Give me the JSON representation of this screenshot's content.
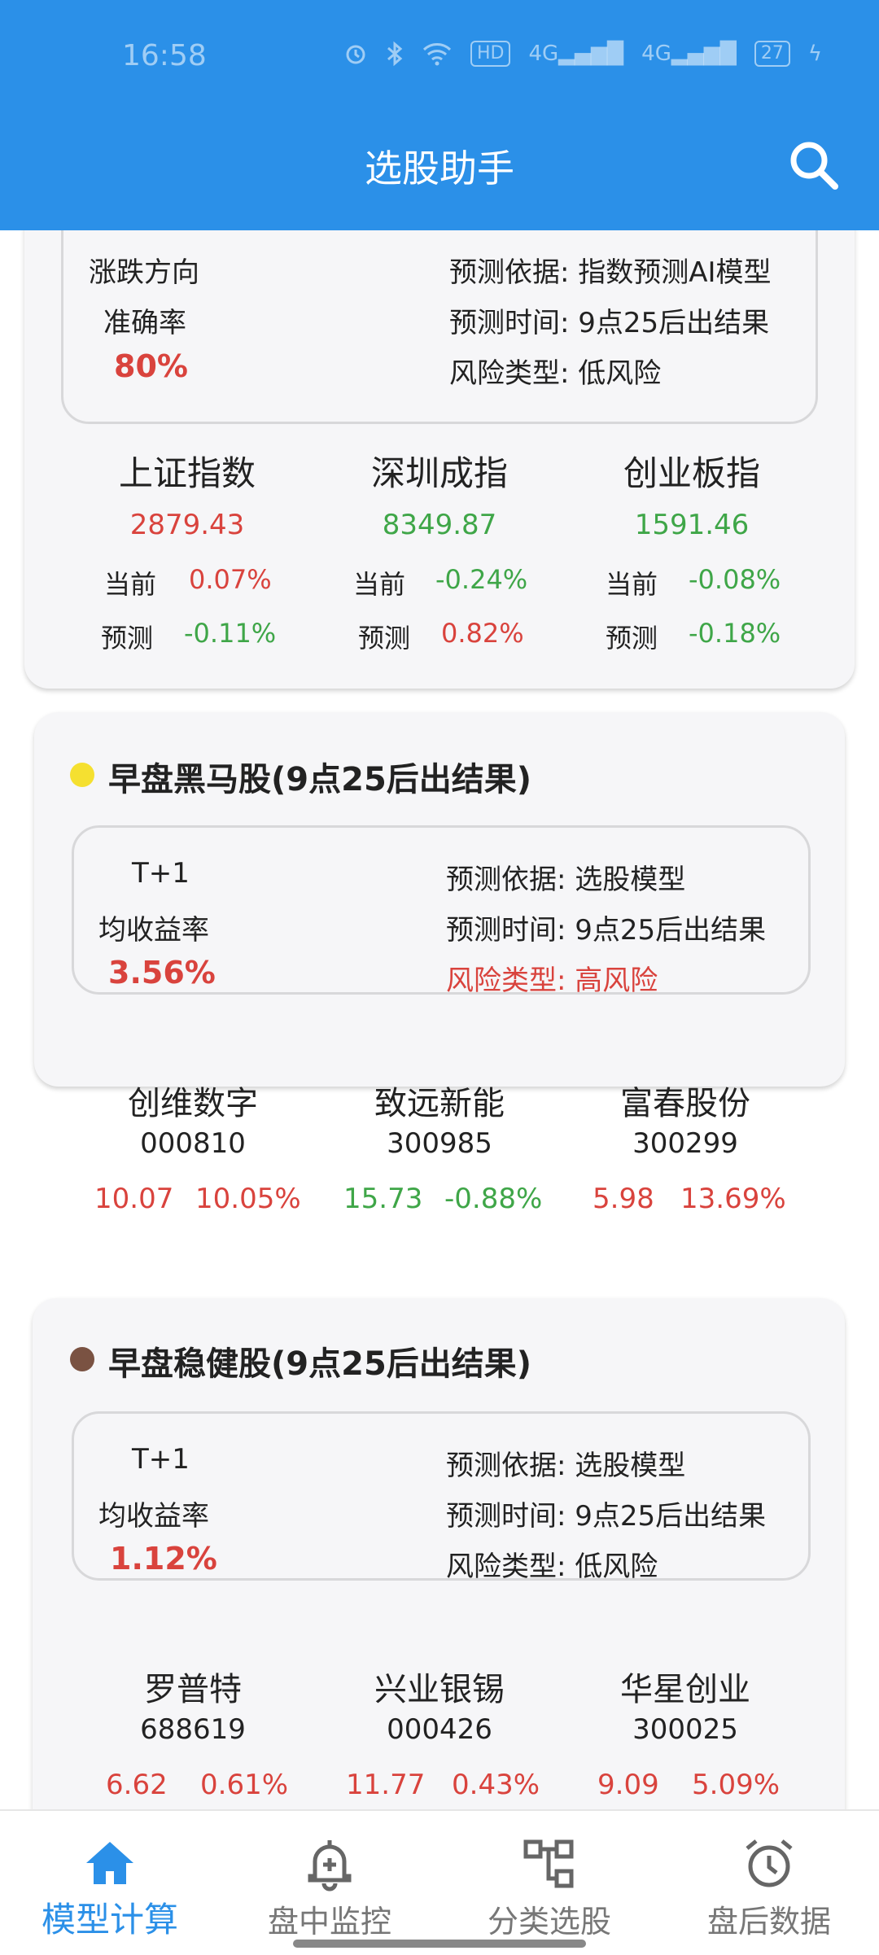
{
  "status": {
    "time": "16:58",
    "icons": [
      "alarm-icon",
      "bluetooth-icon",
      "wifi-icon",
      "hd-icon",
      "signal-4g-icon",
      "signal-4g-icon",
      "battery-icon",
      "charging-icon"
    ],
    "hd": "HD",
    "net1": "4G",
    "net2": "4G",
    "battery": "27"
  },
  "header": {
    "title": "选股助手"
  },
  "colors": {
    "primary": "#2b90e8",
    "up": "#d9433d",
    "down": "#3fa648",
    "yellow_dot": "#f5e030",
    "brown_dot": "#7a5242"
  },
  "index_card": {
    "left_label1": "涨跌方向",
    "left_label2": "准确率",
    "metric": "80%",
    "basis": "预测依据: 指数预测AI模型",
    "time": "预测时间: 9点25后出结果",
    "risk": "风险类型: 低风险",
    "indices": [
      {
        "name": "上证指数",
        "value": "2879.43",
        "cur_label": "当前",
        "cur": "0.07%",
        "pred_label": "预测",
        "pred": "-0.11%"
      },
      {
        "name": "深圳成指",
        "value": "8349.87",
        "cur_label": "当前",
        "cur": "-0.24%",
        "pred_label": "预测",
        "pred": "0.82%"
      },
      {
        "name": "创业板指",
        "value": "1591.46",
        "cur_label": "当前",
        "cur": "-0.08%",
        "pred_label": "预测",
        "pred": "-0.18%"
      }
    ]
  },
  "card2": {
    "title": "早盘黑马股(9点25后出结果)",
    "left_label1": "T+1",
    "left_label2": "均收益率",
    "metric": "3.56%",
    "basis": "预测依据: 选股模型",
    "time": "预测时间: 9点25后出结果",
    "risk": "风险类型: 高风险",
    "stocks": [
      {
        "name": "创维数字",
        "code": "000810",
        "price": "10.07",
        "change": "10.05%"
      },
      {
        "name": "致远新能",
        "code": "300985",
        "price": "15.73",
        "change": "-0.88%"
      },
      {
        "name": "富春股份",
        "code": "300299",
        "price": "5.98",
        "change": "13.69%"
      }
    ]
  },
  "card3": {
    "title": "早盘稳健股(9点25后出结果)",
    "left_label1": "T+1",
    "left_label2": "均收益率",
    "metric": "1.12%",
    "basis": "预测依据: 选股模型",
    "time": "预测时间: 9点25后出结果",
    "risk": "风险类型: 低风险",
    "stocks": [
      {
        "name": "罗普特",
        "code": "688619",
        "price": "6.62",
        "change": "0.61%"
      },
      {
        "name": "兴业银锡",
        "code": "000426",
        "price": "11.77",
        "change": "0.43%"
      },
      {
        "name": "华星创业",
        "code": "300025",
        "price": "9.09",
        "change": "5.09%"
      }
    ]
  },
  "nav": [
    {
      "label": "模型计算",
      "icon": "home-icon",
      "active": true
    },
    {
      "label": "盘中监控",
      "icon": "bell-plus-icon",
      "active": false
    },
    {
      "label": "分类选股",
      "icon": "category-tree-icon",
      "active": false
    },
    {
      "label": "盘后数据",
      "icon": "alarm-clock-icon",
      "active": false
    }
  ]
}
